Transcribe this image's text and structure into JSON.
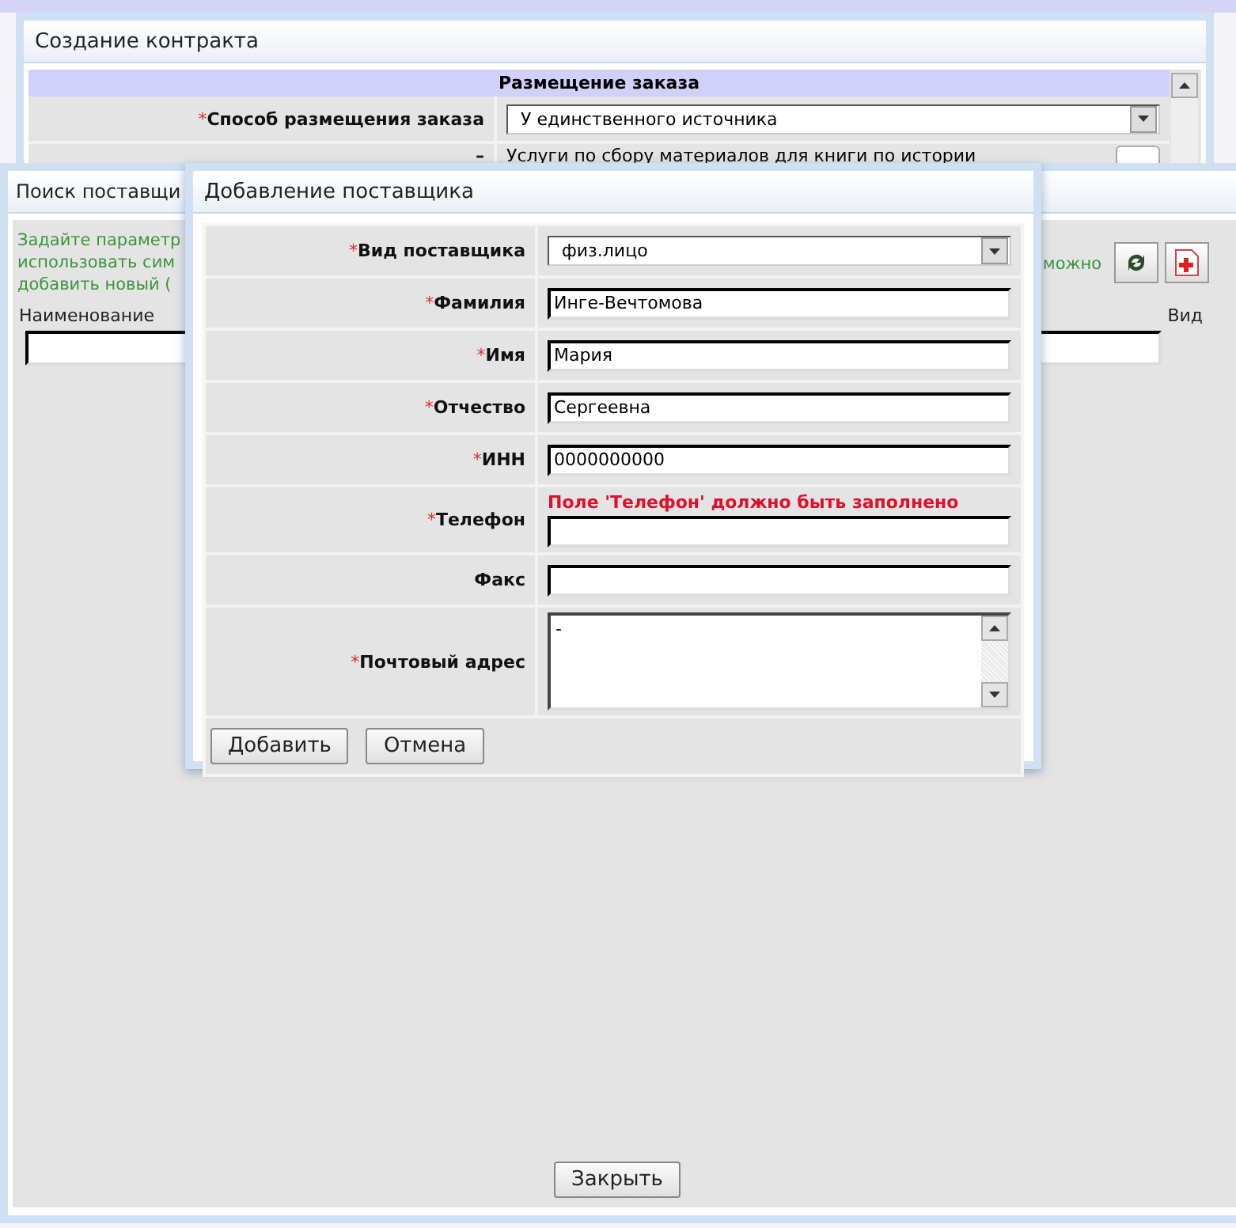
{
  "contract_dialog": {
    "title": "Создание контракта",
    "section_title": "Размещение заказа",
    "fields": [
      {
        "kind": "select",
        "label": "Способ размещения заказа",
        "marker": "*",
        "value": "У единственного источника"
      },
      {
        "kind": "lookup",
        "label": "–",
        "value": "Услуги по сбору материалов для книги по истории"
      }
    ]
  },
  "search_dialog": {
    "title": "Поиск поставщи",
    "hint_left": [
      "Задайте параметр",
      "использовать сим",
      "добавить новый ("
    ],
    "hint_right": [
      "можно"
    ],
    "columns": [
      "Наименование",
      "Вид"
    ],
    "close_button": "Закрыть"
  },
  "add_dialog": {
    "title": "Добавление поставщика",
    "fields": [
      {
        "kind": "select",
        "label": "Вид поставщика",
        "marker": "*",
        "value": "физ.лицо"
      },
      {
        "kind": "text",
        "label": "Фамилия",
        "marker": "*",
        "value": "Инге-Вечтомова"
      },
      {
        "kind": "text",
        "label": "Имя",
        "marker": "*",
        "value": "Мария"
      },
      {
        "kind": "text",
        "label": "Отчество",
        "marker": "*",
        "value": "Сергеевна"
      },
      {
        "kind": "text",
        "label": "ИНН",
        "marker": "*",
        "value": "0000000000"
      },
      {
        "kind": "text",
        "label": "Телефон",
        "marker": "*",
        "error": "Поле 'Телефон' должно быть заполнено"
      },
      {
        "kind": "text",
        "label": "Факс"
      },
      {
        "kind": "textarea",
        "label": "Почтовый адрес",
        "marker": "*",
        "value": "-"
      }
    ],
    "buttons": [
      "Добавить",
      "Отмена"
    ]
  }
}
